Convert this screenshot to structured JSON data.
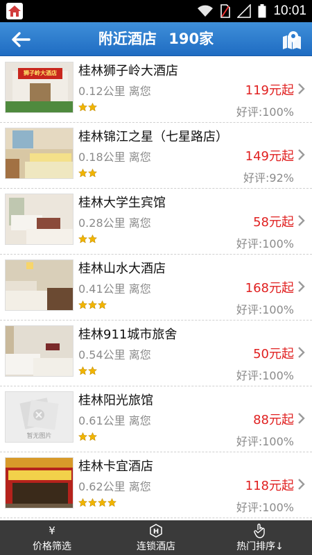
{
  "status": {
    "time": "10:01"
  },
  "header": {
    "title": "附近酒店",
    "count": "190家"
  },
  "hotels": [
    {
      "name": "桂林狮子岭大酒店",
      "distance": "0.12公里 离您",
      "price": "119元起",
      "rating": "好评:100%",
      "stars": 2,
      "sign": "狮子岭大酒店"
    },
    {
      "name": "桂林锦江之星（七星路店）",
      "distance": "0.18公里 离您",
      "price": "149元起",
      "rating": "好评:92%",
      "stars": 2
    },
    {
      "name": "桂林大学生宾馆",
      "distance": "0.28公里 离您",
      "price": "58元起",
      "rating": "好评:100%",
      "stars": 2
    },
    {
      "name": "桂林山水大酒店",
      "distance": "0.41公里 离您",
      "price": "168元起",
      "rating": "好评:100%",
      "stars": 3
    },
    {
      "name": "桂林911城市旅舍",
      "distance": "0.54公里 离您",
      "price": "50元起",
      "rating": "好评:100%",
      "stars": 2
    },
    {
      "name": "桂林阳光旅馆",
      "distance": "0.61公里 离您",
      "price": "88元起",
      "rating": "好评:100%",
      "stars": 2,
      "placeholder": "暂无图片"
    },
    {
      "name": "桂林卡宜酒店",
      "distance": "0.62公里 离您",
      "price": "118元起",
      "rating": "好评:100%",
      "stars": 4
    }
  ],
  "bottom_tabs": [
    {
      "label": "价格筛选",
      "icon": "yen-icon",
      "glyph": "¥"
    },
    {
      "label": "连锁酒店",
      "icon": "hotel-chain-icon",
      "glyph": ""
    },
    {
      "label": "热门排序↓",
      "icon": "hand-icon",
      "glyph": ""
    }
  ],
  "colors": {
    "header": "#2a7bd0",
    "price": "#e02020",
    "star": "#f0b400",
    "bottom_bar": "#3a3a3a"
  }
}
